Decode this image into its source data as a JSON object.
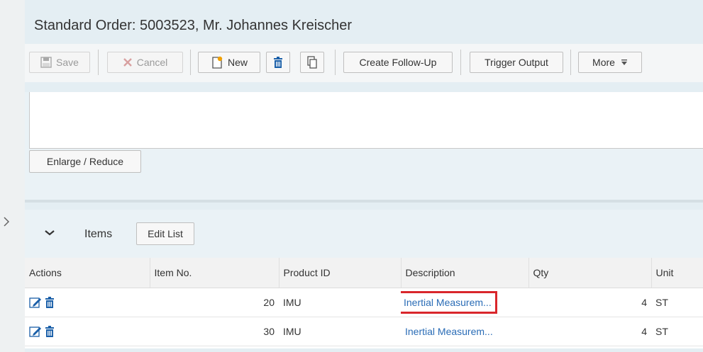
{
  "page": {
    "title": "Standard Order: 5003523, Mr. Johannes Kreischer"
  },
  "toolbar": {
    "save_label": "Save",
    "cancel_label": "Cancel",
    "new_label": "New",
    "create_follow_up_label": "Create Follow-Up",
    "trigger_output_label": "Trigger Output",
    "more_label": "More"
  },
  "header": {
    "enlarge_reduce_label": "Enlarge / Reduce"
  },
  "items_section": {
    "title": "Items",
    "edit_list_label": "Edit List",
    "columns": [
      "Actions",
      "Item No.",
      "Product ID",
      "Description",
      "Qty",
      "Unit"
    ],
    "rows": [
      {
        "item_no": "20",
        "product_id": "IMU",
        "description": "Inertial Measurem...",
        "qty": "4",
        "unit": "ST"
      },
      {
        "item_no": "30",
        "product_id": "IMU",
        "description": "Inertial Measurem...",
        "qty": "4",
        "unit": "ST"
      }
    ]
  },
  "icons": {
    "save": "floppy-disk-icon",
    "cancel": "x-icon",
    "new": "new-document-icon",
    "delete": "trash-icon",
    "copy": "copy-icon",
    "more": "dropdown-arrow-icon",
    "edit": "pencil-icon",
    "collapse": "chevron-down-icon",
    "expand_rail": "chevron-right-icon"
  },
  "colors": {
    "link": "#2a6cb6",
    "highlight": "#d9262b",
    "icon_blue": "#1a5fa8",
    "new_star": "#f0a000"
  }
}
